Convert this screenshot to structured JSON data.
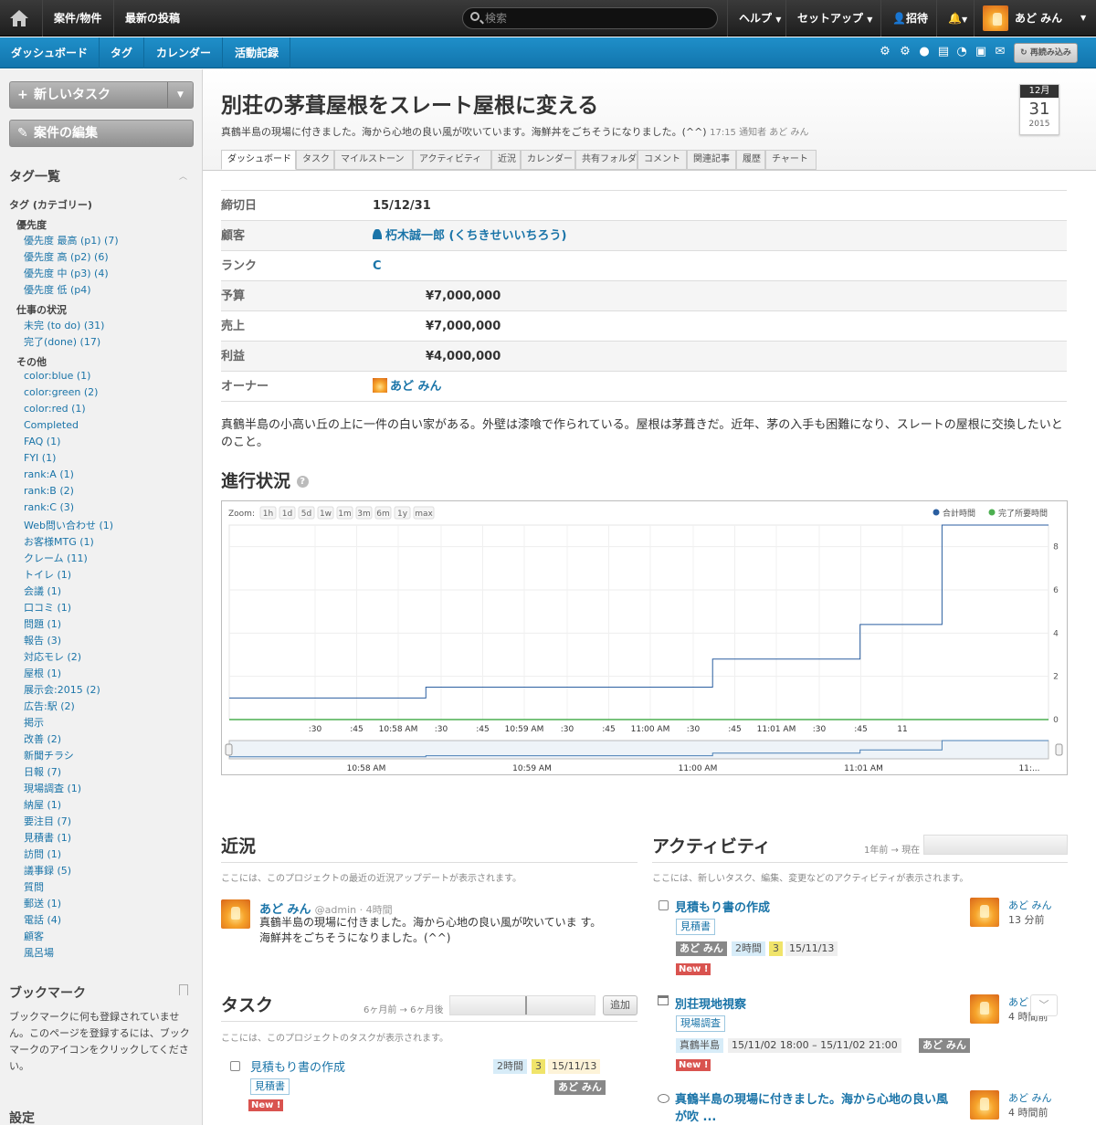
{
  "topbar": {
    "projects": "案件/物件",
    "recent_posts": "最新の投稿",
    "search_placeholder": "検索",
    "help": "ヘルプ",
    "setup": "セットアップ",
    "invite": "招待",
    "user_name": "あど みん"
  },
  "subnav": {
    "dashboard": "ダッシュボード",
    "tags": "タグ",
    "calendar": "カレンダー",
    "activity_log": "活動記録",
    "reload": "再読み込み"
  },
  "sidebar": {
    "new_task": "新しいタスク",
    "edit_project": "案件の編集",
    "tags_title": "タグ一覧",
    "tags_category": "タグ (カテゴリー)",
    "groups": [
      {
        "name": "優先度",
        "items": [
          "優先度 最高 (p1) (7)",
          "優先度 高 (p2) (6)",
          "優先度 中 (p3) (4)",
          "優先度 低 (p4)"
        ]
      },
      {
        "name": "仕事の状況",
        "items": [
          "未完 (to do) (31)",
          "完了(done) (17)"
        ]
      },
      {
        "name": "その他",
        "items": [
          "color:blue (1)",
          "color:green (2)",
          "color:red (1)",
          "Completed",
          "FAQ (1)",
          "FYI (1)",
          "rank:A (1)",
          "rank:B (2)",
          "rank:C (3)",
          "Web問い合わせ (1)",
          "お客様MTG (1)",
          "クレーム (11)",
          "トイレ (1)",
          "会議 (1)",
          "口コミ (1)",
          "問題 (1)",
          "報告 (3)",
          "対応モレ (2)",
          "屋根 (1)",
          "展示会:2015 (2)",
          "広告:駅 (2)",
          "掲示",
          "改善 (2)",
          "新聞チラシ",
          "日報 (7)",
          "現場調査 (1)",
          "納屋 (1)",
          "要注目 (7)",
          "見積書 (1)",
          "訪問 (1)",
          "議事録 (5)",
          "質問",
          "郵送 (1)",
          "電話 (4)",
          "顧客",
          "風呂場"
        ]
      }
    ],
    "bookmarks_title": "ブックマーク",
    "bookmarks_text": "ブックマークに何も登録されていません。このページを登録するには、ブックマークのアイコンをクリックしてください。",
    "settings_title": "設定"
  },
  "project": {
    "title": "別荘の茅葺屋根をスレート屋根に変える",
    "subtitle": "真鶴半島の現場に付きました。海から心地の良い風が吹いています。海鮮丼をごちそうになりました。(^^)",
    "subtitle_meta": "17:15 通知者 あど みん",
    "calendar": {
      "month": "12月",
      "day": "31",
      "year": "2015"
    }
  },
  "tabs": [
    "ダッシュボード",
    "タスク",
    "マイルストーン",
    "アクティビティ",
    "近況",
    "カレンダー",
    "共有フォルダ",
    "コメント",
    "関連記事",
    "履歴",
    "チャート"
  ],
  "details": [
    {
      "label": "締切日",
      "value": "15/12/31"
    },
    {
      "label": "顧客",
      "value": "朽木誠一郎 (くちきせいいちろう)"
    },
    {
      "label": "ランク",
      "value": "C"
    },
    {
      "label": "予算",
      "value": "¥7,000,000"
    },
    {
      "label": "売上",
      "value": "¥7,000,000"
    },
    {
      "label": "利益",
      "value": "¥4,000,000"
    },
    {
      "label": "オーナー",
      "value": "あど みん"
    }
  ],
  "description": "真鶴半島の小高い丘の上に一件の白い家がある。外壁は漆喰で作られている。屋根は茅葺きだ。近年、茅の入手も困難になり、スレートの屋根に交換したいとのこと。",
  "progress_title": "進行状況",
  "chart_data": {
    "type": "line",
    "zoom_label": "Zoom:",
    "zoom_options": [
      "1h",
      "1d",
      "5d",
      "1w",
      "1m",
      "3m",
      "6m",
      "1y",
      "max"
    ],
    "series": [
      {
        "name": "合計時間",
        "color": "#2a5ea0"
      },
      {
        "name": "完了所要時間",
        "color": "#4caf50"
      }
    ],
    "x_ticks": [
      ":30",
      ":45",
      "10:58 AM",
      ":30",
      ":45",
      "10:59 AM",
      ":30",
      ":45",
      "11:00 AM",
      ":30",
      ":45",
      "11:01 AM",
      ":30",
      ":45",
      "11"
    ],
    "y_ticks": [
      "0",
      "2",
      "4",
      "6",
      "8"
    ],
    "ylim": [
      0,
      9
    ],
    "steps": [
      {
        "x": 0.0,
        "y": 1.0
      },
      {
        "x": 0.24,
        "y": 1.5
      },
      {
        "x": 0.59,
        "y": 2.8
      },
      {
        "x": 0.77,
        "y": 4.4
      },
      {
        "x": 0.87,
        "y": 9.0
      }
    ],
    "navigator_ticks": [
      "10:58 AM",
      "10:59 AM",
      "11:00 AM",
      "11:01 AM",
      "11:..."
    ]
  },
  "recent": {
    "title": "近況",
    "note": "ここには、このプロジェクトの最近の近況アップデートが表示されます。",
    "post": {
      "author": "あど みん",
      "handle": "@admin · 4時間",
      "text": "真鶴半島の現場に付きました。海から心地の良い風が吹いていま す。海鮮丼をごちそうになりました。(^^)"
    }
  },
  "tasks": {
    "title": "タスク",
    "range": "6ヶ月前 → 6ヶ月後",
    "add": "追加",
    "note": "ここには、このプロジェクトのタスクが表示されます。",
    "items": [
      {
        "name": "見積もり書の作成",
        "hours": "2時間",
        "priority": "3",
        "date": "15/11/13",
        "tag": "見積書",
        "owner": "あど みん",
        "new": "New !"
      }
    ]
  },
  "activity": {
    "title": "アクティビティ",
    "range": "1年前 → 現在",
    "note": "ここには、新しいタスク、編集、変更などのアクティビティが表示されます。",
    "items": [
      {
        "name": "見積もり書の作成",
        "tag": "見積書",
        "owner": "あど みん",
        "hours": "2時間",
        "priority": "3",
        "date": "15/11/13",
        "new": "New !",
        "user": "あど みん",
        "time": "13 分前"
      },
      {
        "name": "別荘現地視察",
        "tag": "現場調査",
        "place": "真鶴半島",
        "period": "15/11/02 18:00 – 15/11/02 21:00",
        "owner": "あど みん",
        "new": "New !",
        "user": "あど",
        "time": "4 時間前"
      },
      {
        "name": "真鶴半島の現場に付きました。海から心地の良い風が吹 ...",
        "user": "あど みん",
        "time": "4 時間前"
      }
    ]
  }
}
